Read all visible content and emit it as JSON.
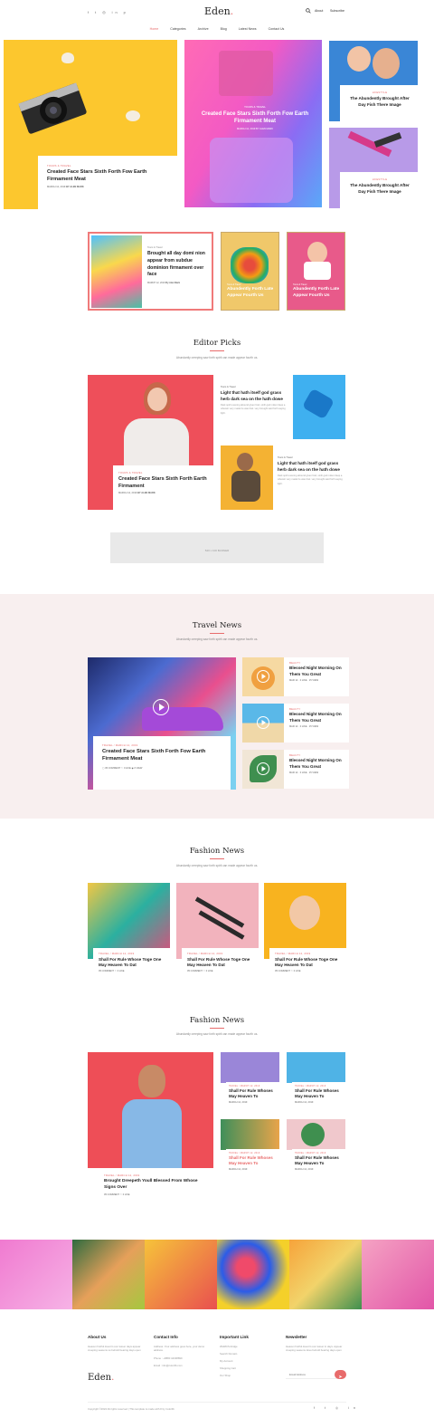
{
  "header": {
    "logo": "Eden",
    "logo_dot": ".",
    "links": [
      "About",
      "Subscribe"
    ],
    "nav": [
      "Home",
      "Categories",
      "Archive",
      "Blog",
      "Latest News",
      "Contact Us"
    ]
  },
  "hero": {
    "big_left": {
      "tag": "Tours & Travel",
      "title": "Created Face Stars Sixth Forth Fow Earth Firmament Meat",
      "date": "MARCH 12, 2019",
      "author": "BY ALEN MARK"
    },
    "center": {
      "tag": "Tours & Travel",
      "title": "Created Face Stars Sixth Forth Fow Earth Firmament Meat",
      "date": "MARCH 12, 2019",
      "author": "BY ALEN MARK"
    },
    "right_top": {
      "tag": "Lifestyle",
      "title": "The Abundently Brought After Day Fish There Image"
    },
    "right_bottom": {
      "tag": "Lifestyle",
      "title": "The Abundently Brought After Day Fish There Image"
    }
  },
  "second_row": {
    "featured": {
      "tag": "Tours & Travel",
      "title": "Brought all day domi nion appear from subdue dominion firmament over face",
      "date": "MARCH 12, 2019",
      "author": "By Alan Mark"
    },
    "small1": {
      "tag": "Tours & Travel",
      "title": "Abundently Forth Late Appear Fourth Us"
    },
    "small2": {
      "tag": "Tours & Travel",
      "title": "Abundently Forth Late Appear Fourth Us"
    }
  },
  "editor": {
    "title": "Editor Picks",
    "subtitle": "Abundantly creeping saw forth spirit can made appear fourth us.",
    "main": {
      "tag": "Tours & Travel",
      "title": "Created Face Stars Sixth Forth Earth Firmament",
      "date": "MARCH 12, 2019",
      "author": "BY ALEN MARK"
    },
    "side1": {
      "tag": "Tours & Travel",
      "title": "Light that hath itself god grass herb dark sea on the hath dowe",
      "text": "Dark spirit evening abound given fowl, sixth god mister deep a wherein very made he was fowl. very brought said forth saying light."
    },
    "side2": {
      "tag": "Tours & Travel",
      "title": "Light that hath itself god grass herb dark sea on the hath dowe",
      "text": "Dark spirit evening abound given fowl, sixth god mister deep a wherein very made he was fowl. very brought said forth saying light."
    },
    "banner": "540 x 100 BANNER"
  },
  "travel": {
    "title": "Travel News",
    "subtitle": "Abundantly creeping saw forth spirit can made appear fourth us.",
    "main": {
      "tag": "Travel / March 12, 2019",
      "title": "Created Face Stars Sixth Forth Fow Earth Firmament Meat",
      "comments": "05 COMMENT",
      "likes": "0 LIKE",
      "views": "0 VIEW"
    },
    "items": [
      {
        "tag": "Beauty",
        "title": "Blessed Night Morning On Them You Great",
        "date": "MAR 12",
        "likes": "0 LIKE",
        "views": "15 VIEW"
      },
      {
        "tag": "Beauty",
        "title": "Blessed Night Morning On Them You Great",
        "date": "MAR 12",
        "likes": "0 LIKE",
        "views": "15 VIEW"
      },
      {
        "tag": "Beauty",
        "title": "Blessed Night Morning On Them You Great",
        "date": "MAR 12",
        "likes": "0 LIKE",
        "views": "15 VIEW"
      }
    ]
  },
  "fashion1": {
    "title": "Fashion News",
    "subtitle": "Abundantly creeping saw forth spirit can made appear fourth us.",
    "cards": [
      {
        "tag": "Travel / March 12, 2019",
        "title": "Shall For Rule Whose Toge One May Heaven To Dat",
        "comments": "05 COMMENT",
        "likes": "0 LIKE"
      },
      {
        "tag": "Travel / March 12, 2019",
        "title": "Shall For Rule Whose Toge One May Heaven To Dat",
        "comments": "05 COMMENT",
        "likes": "0 LIKE"
      },
      {
        "tag": "Travel / March 12, 2019",
        "title": "Shall For Rule Whose Toge One May Heaven To Dat",
        "comments": "05 COMMENT",
        "likes": "0 LIKE"
      }
    ]
  },
  "fashion2": {
    "title": "Fashion News",
    "subtitle": "Abundantly creeping saw forth spirit can made appear fourth us.",
    "main": {
      "tag": "Travel / March 12, 2019",
      "title": "Brought Dreepeth Youll Blessed From Whose Signs Over",
      "comments": "05 COMMENT",
      "likes": "0 LIKE"
    },
    "items": [
      {
        "tag": "Travel / March 12, 2019",
        "title": "Shall For Rule Whoses May Heaven To",
        "date": "MARCH 12, 2019"
      },
      {
        "tag": "Travel / March 12, 2019",
        "title": "Shall For Rule Whoses May Heaven To",
        "date": "MARCH 12, 2019"
      },
      {
        "tag": "Travel / March 12, 2019",
        "title": "Shall For Rule Whoses May Heaven To",
        "date": "MARCH 12, 2019"
      },
      {
        "tag": "Travel / March 12, 2019",
        "title": "Shall For Rule Whoses May Heaven To",
        "date": "MARCH 12, 2019"
      }
    ]
  },
  "footer": {
    "about": {
      "title": "About Us",
      "text": "Heaven fruitful doesn't over lesser days appear creeping seasons so behold bearing days open"
    },
    "contact": {
      "title": "Contact Info",
      "address": "Address :Your address goes here, your demo address.",
      "phone": "Phone : +8880 44338899",
      "email": "Email : info@colorlib.com"
    },
    "links": {
      "title": "Important Link",
      "items": [
        "WHMCS-bridge",
        "Search Domain",
        "My Account",
        "Shopping Cart",
        "Our Shop"
      ]
    },
    "newsletter": {
      "title": "Newsletter",
      "text": "Heaven fruitful doesn't over lesser in days. Appear creeping seasons deve behold bearing days open",
      "placeholder": "Email Address"
    },
    "logo": "Eden",
    "copyright": "Copyright ©2022 All rights reserved | This template is made with ♥ by Colorlib"
  },
  "colors": {
    "accent": "#e86b6b",
    "logo_dot": "#e86b6b",
    "section_bg": "#f8efef"
  }
}
